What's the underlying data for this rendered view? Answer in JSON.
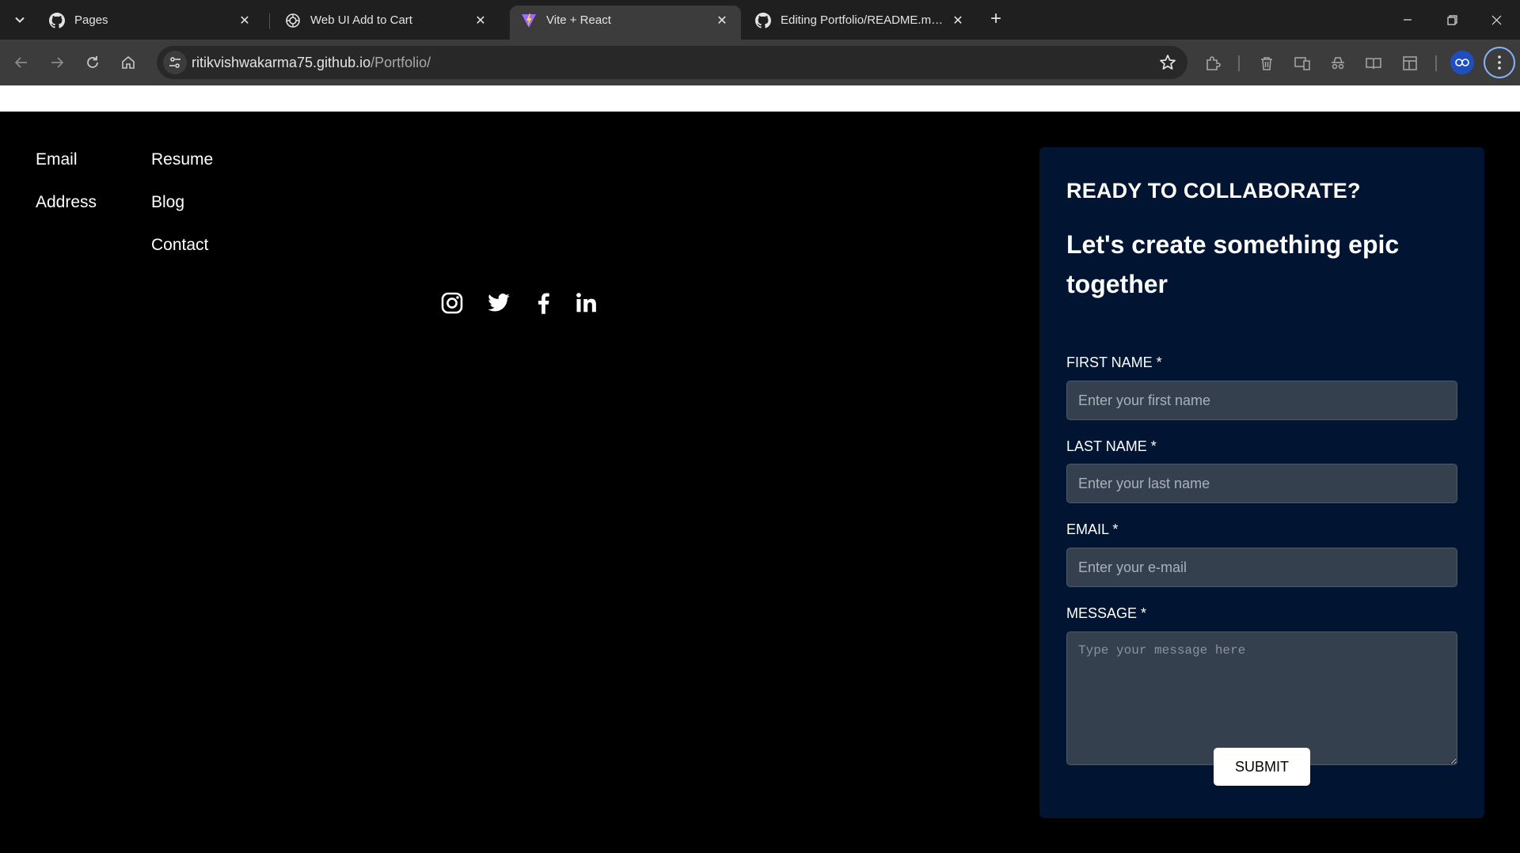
{
  "browser": {
    "tabs": [
      {
        "title": "Pages",
        "icon": "github-icon",
        "active": false
      },
      {
        "title": "Web UI Add to Cart",
        "icon": "openai-icon",
        "active": false
      },
      {
        "title": "Vite + React",
        "icon": "vite-icon",
        "active": true
      },
      {
        "title": "Editing Portfolio/README.md a",
        "icon": "github-icon",
        "active": false
      }
    ],
    "new_tab_label": "+",
    "close_glyph": "✕",
    "address": {
      "host": "ritikvishwakarma75.github.io",
      "path": "/Portfolio/"
    }
  },
  "footer": {
    "col1": [
      "Email",
      "Address"
    ],
    "col2": [
      "Resume",
      "Blog",
      "Contact"
    ],
    "socials": [
      "instagram-icon",
      "twitter-icon",
      "facebook-icon",
      "linkedin-icon"
    ]
  },
  "contact_form": {
    "kicker": "READY TO COLLABORATE?",
    "heading": "Let's create something epic together",
    "first_name": {
      "label": "FIRST NAME *",
      "placeholder": "Enter your first name"
    },
    "last_name": {
      "label": "LAST NAME *",
      "placeholder": "Enter your last name"
    },
    "email": {
      "label": "EMAIL *",
      "placeholder": "Enter your e-mail"
    },
    "message": {
      "label": "MESSAGE *",
      "placeholder": "Type your message here"
    },
    "submit_label": "SUBMIT"
  },
  "colors": {
    "panel_bg": "#011533",
    "input_bg": "#35404f",
    "accent_ring": "#8ab4f8"
  }
}
